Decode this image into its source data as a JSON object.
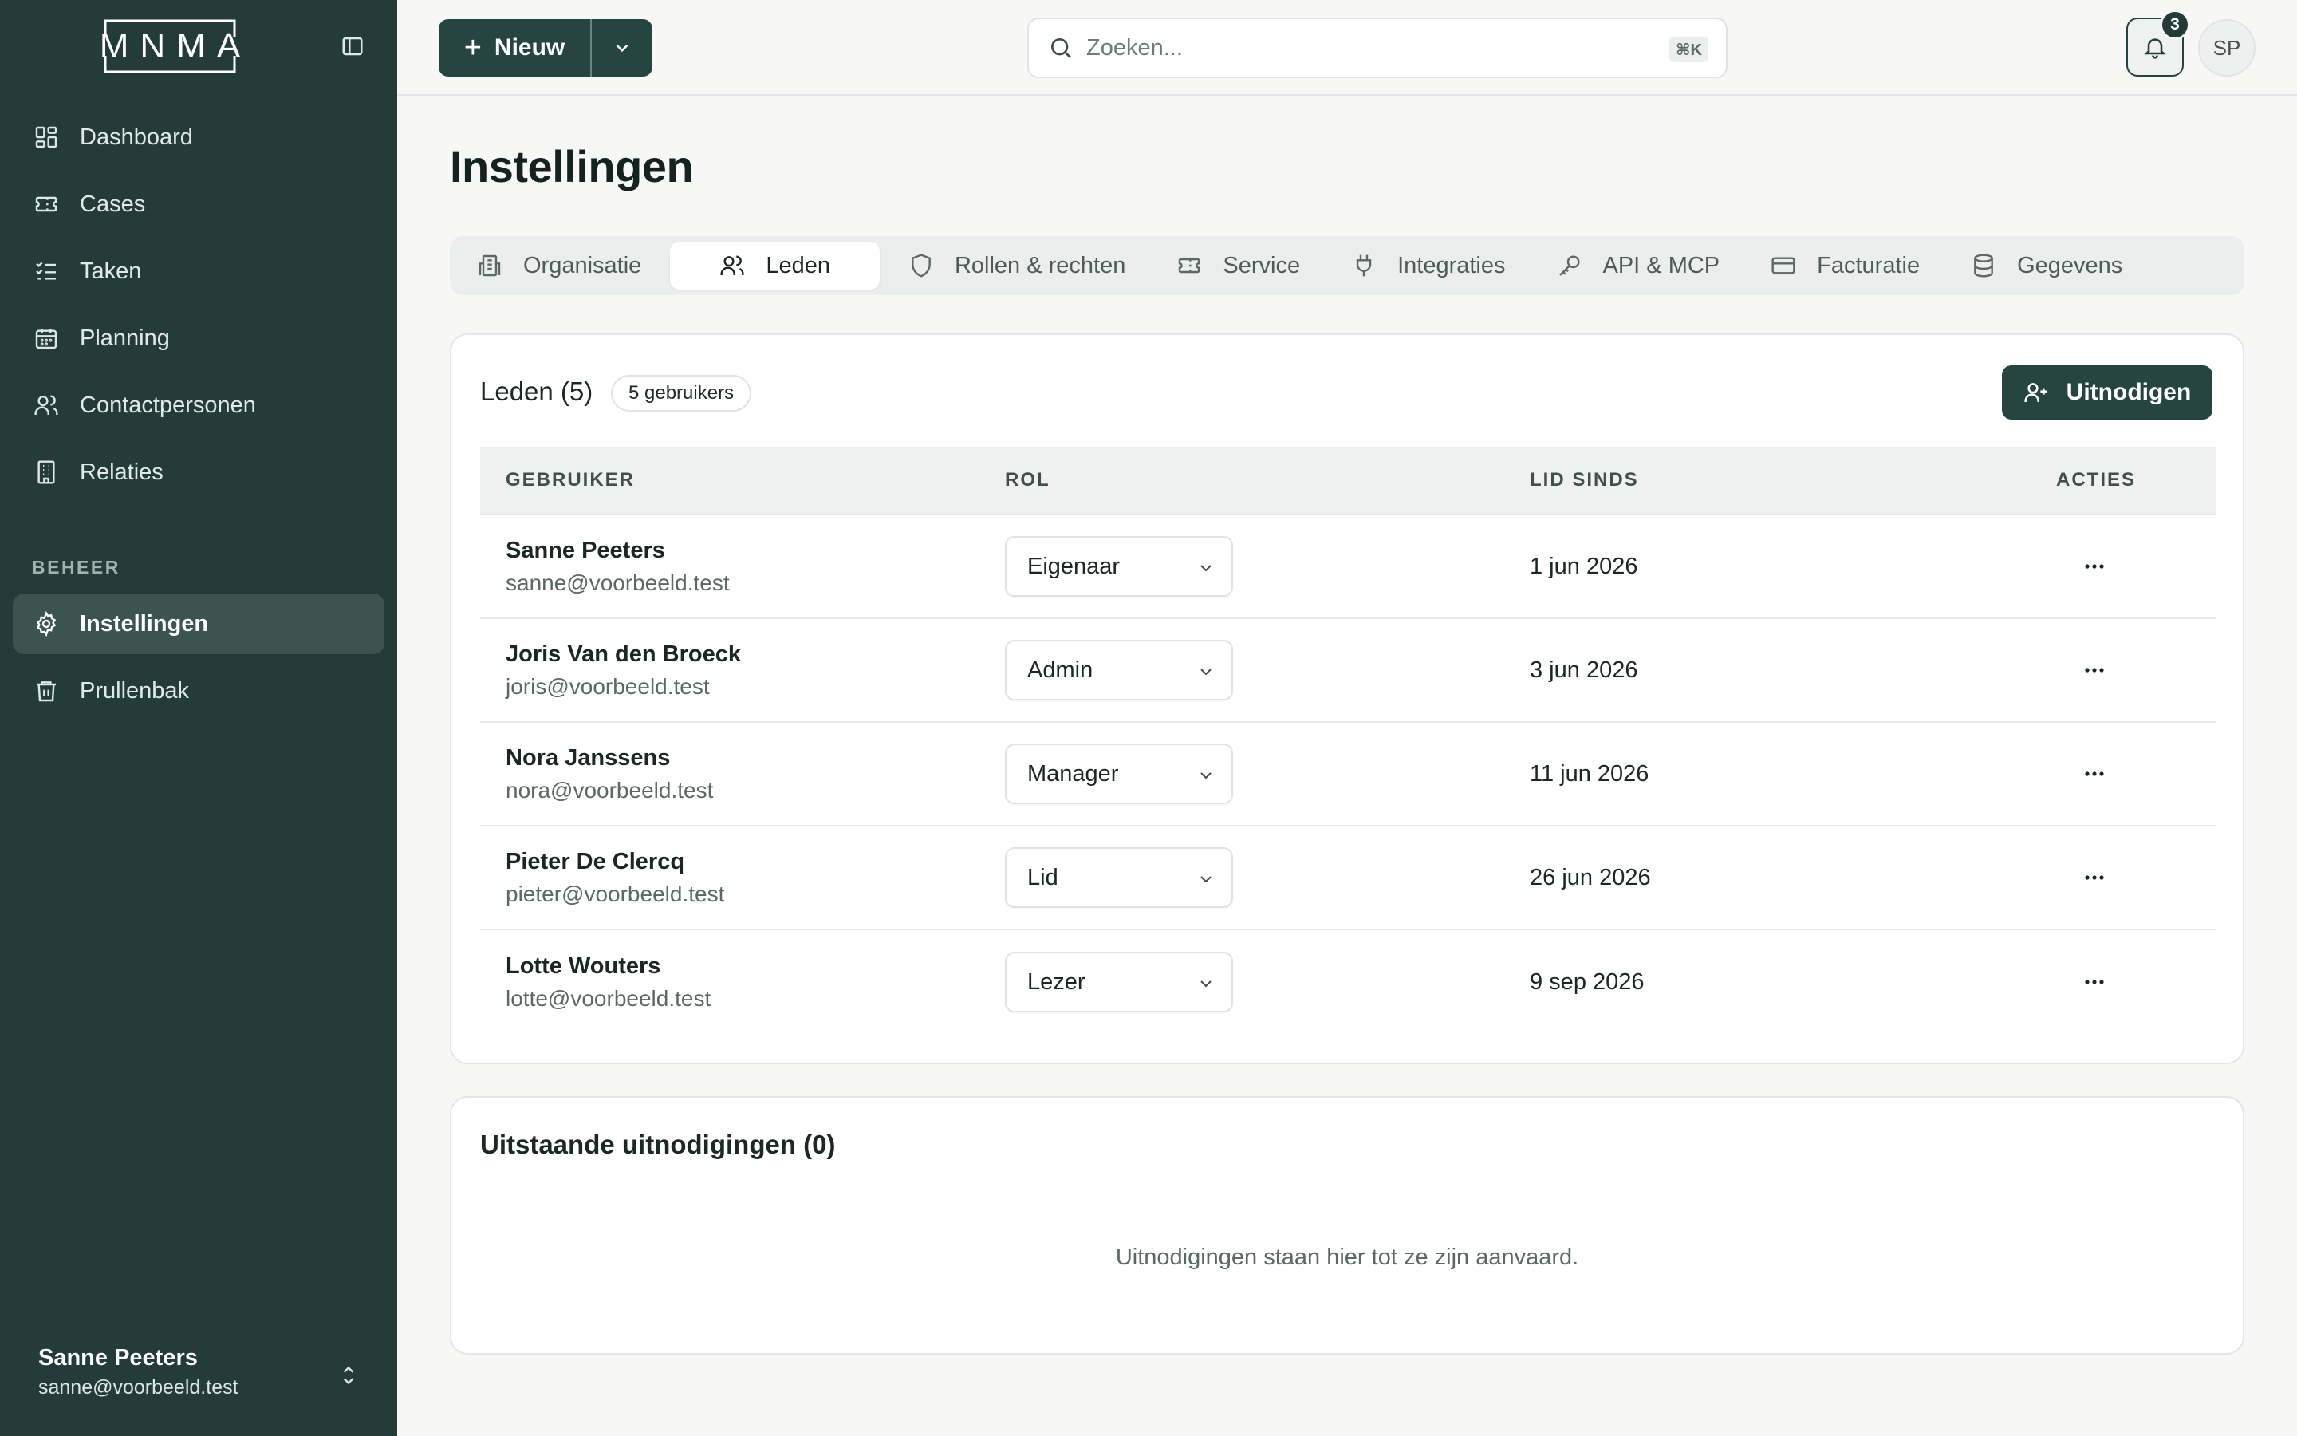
{
  "app": {
    "logo_text": "MNMA",
    "colors": {
      "sidebar": "#243c39",
      "accent": "#264541",
      "active_nav": "#3b5450"
    }
  },
  "sidebar": {
    "items": [
      {
        "label": "Dashboard",
        "icon": "dashboard-icon"
      },
      {
        "label": "Cases",
        "icon": "ticket-icon"
      },
      {
        "label": "Taken",
        "icon": "tasks-icon"
      },
      {
        "label": "Planning",
        "icon": "calendar-icon"
      },
      {
        "label": "Contactpersonen",
        "icon": "users-icon"
      },
      {
        "label": "Relaties",
        "icon": "building-icon"
      }
    ],
    "section_label": "BEHEER",
    "admin_items": [
      {
        "label": "Instellingen",
        "icon": "gear-icon",
        "active": true
      },
      {
        "label": "Prullenbak",
        "icon": "trash-icon"
      }
    ],
    "user": {
      "name": "Sanne Peeters",
      "email": "sanne@voorbeeld.test"
    }
  },
  "topbar": {
    "new_label": "Nieuw",
    "search_placeholder": "Zoeken...",
    "search_shortcut": "⌘K",
    "notification_count": "3",
    "avatar_initials": "SP"
  },
  "page": {
    "title": "Instellingen",
    "tabs": [
      {
        "label": "Organisatie",
        "icon": "building-icon"
      },
      {
        "label": "Leden",
        "icon": "users-icon",
        "active": true
      },
      {
        "label": "Rollen & rechten",
        "icon": "shield-icon"
      },
      {
        "label": "Service",
        "icon": "ticket-icon"
      },
      {
        "label": "Integraties",
        "icon": "plug-icon"
      },
      {
        "label": "API & MCP",
        "icon": "key-icon"
      },
      {
        "label": "Facturatie",
        "icon": "credit-card-icon"
      },
      {
        "label": "Gegevens",
        "icon": "database-icon"
      }
    ]
  },
  "members": {
    "title": "Leden (5)",
    "count_badge": "5 gebruikers",
    "invite_label": "Uitnodigen",
    "columns": [
      "GEBRUIKER",
      "ROL",
      "LID SINDS",
      "ACTIES"
    ],
    "rows": [
      {
        "name": "Sanne Peeters",
        "email": "sanne@voorbeeld.test",
        "role": "Eigenaar",
        "since": "1 jun 2026"
      },
      {
        "name": "Joris Van den Broeck",
        "email": "joris@voorbeeld.test",
        "role": "Admin",
        "since": "3 jun 2026"
      },
      {
        "name": "Nora Janssens",
        "email": "nora@voorbeeld.test",
        "role": "Manager",
        "since": "11 jun 2026"
      },
      {
        "name": "Pieter De Clercq",
        "email": "pieter@voorbeeld.test",
        "role": "Lid",
        "since": "26 jun 2026"
      },
      {
        "name": "Lotte Wouters",
        "email": "lotte@voorbeeld.test",
        "role": "Lezer",
        "since": "9 sep 2026"
      }
    ]
  },
  "invites": {
    "title": "Uitstaande uitnodigingen (0)",
    "empty_text": "Uitnodigingen staan hier tot ze zijn aanvaard."
  }
}
